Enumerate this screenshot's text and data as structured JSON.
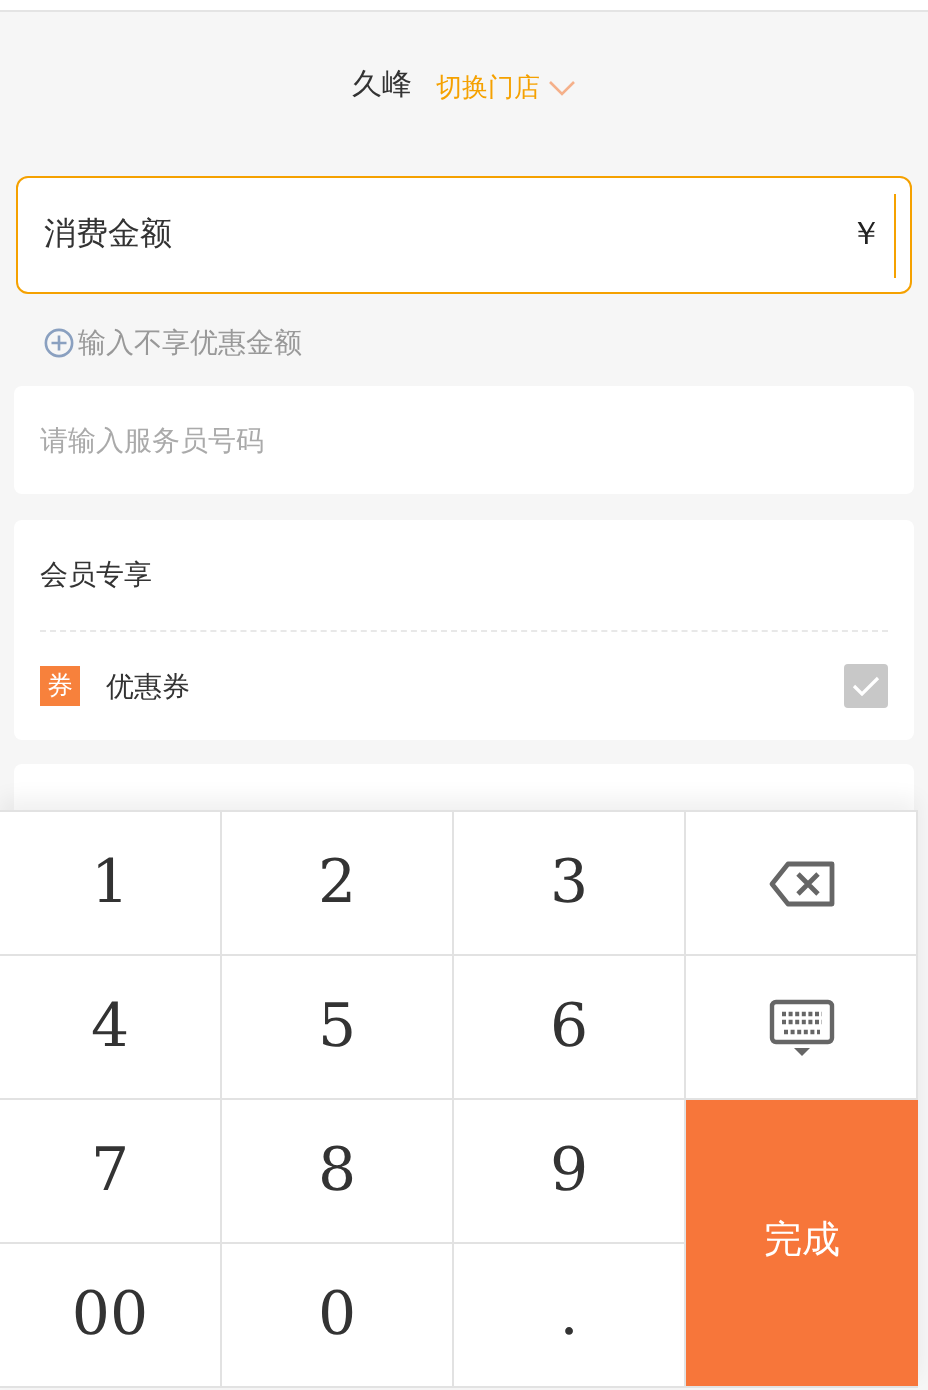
{
  "header": {
    "store_name": "久峰",
    "switch_label": "切换门店"
  },
  "amount_field": {
    "label": "消费金额",
    "currency": "￥",
    "focused": true
  },
  "add_exempt": {
    "label": "输入不享优惠金额"
  },
  "waiter_field": {
    "placeholder": "请输入服务员号码"
  },
  "member_card": {
    "title": "会员专享",
    "items": [
      {
        "badge": "券",
        "label": "优惠券",
        "checked": true
      }
    ]
  },
  "keypad": {
    "keys": [
      {
        "kind": "digit",
        "label": "1"
      },
      {
        "kind": "digit",
        "label": "2"
      },
      {
        "kind": "digit",
        "label": "3"
      },
      {
        "kind": "backspace"
      },
      {
        "kind": "digit",
        "label": "4"
      },
      {
        "kind": "digit",
        "label": "5"
      },
      {
        "kind": "digit",
        "label": "6"
      },
      {
        "kind": "hide"
      },
      {
        "kind": "digit",
        "label": "7"
      },
      {
        "kind": "digit",
        "label": "8"
      },
      {
        "kind": "digit",
        "label": "9"
      },
      {
        "kind": "done",
        "label": "完成"
      },
      {
        "kind": "digit",
        "label": "00"
      },
      {
        "kind": "digit",
        "label": "0"
      },
      {
        "kind": "digit",
        "label": "."
      }
    ]
  }
}
